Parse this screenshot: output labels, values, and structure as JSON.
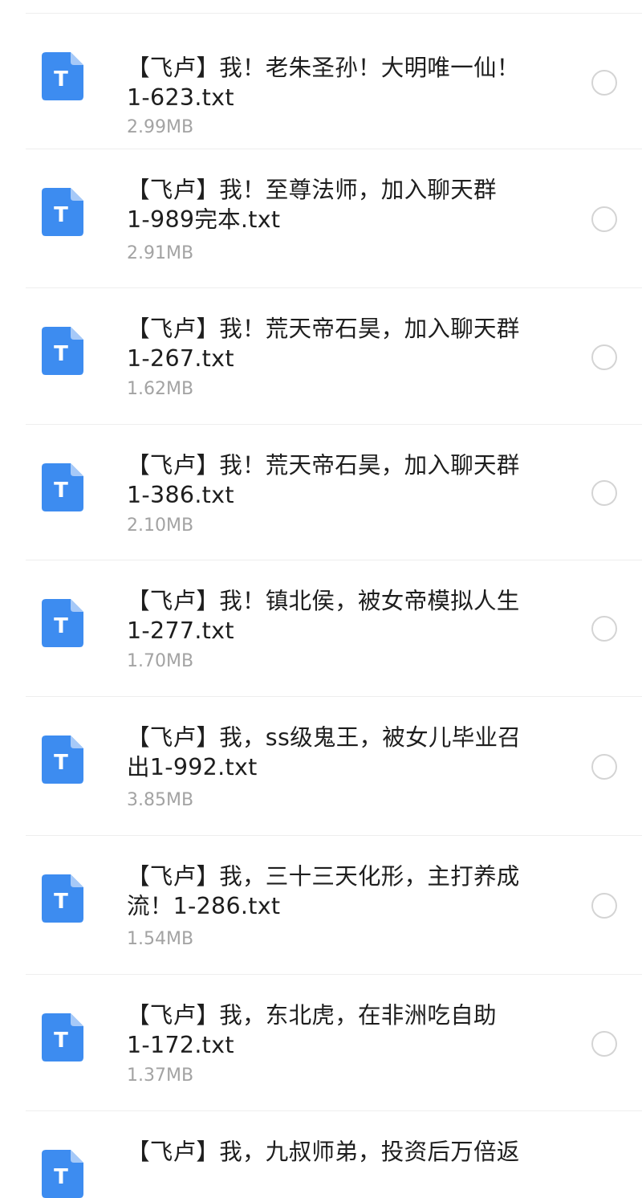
{
  "colors": {
    "icon_blue": "#3d8cf0",
    "icon_fold": "#a6c9f8",
    "name_text": "#1e1e1e",
    "size_text": "#a3a3a3",
    "radio_border": "#d4d4d4",
    "divider": "#eeeeee"
  },
  "file_icon": {
    "name": "txt-file-icon",
    "glyph": "T"
  },
  "files": [
    {
      "name": "【飞卢】我！老朱圣孙！大明唯一仙！\n1-623.txt",
      "size": "2.99MB",
      "selected": false
    },
    {
      "name": "【飞卢】我！至尊法师，加入聊天群\n1-989完本.txt",
      "size": "2.91MB",
      "selected": false
    },
    {
      "name": "【飞卢】我！荒天帝石昊，加入聊天群\n1-267.txt",
      "size": "1.62MB",
      "selected": false
    },
    {
      "name": "【飞卢】我！荒天帝石昊，加入聊天群\n1-386.txt",
      "size": "2.10MB",
      "selected": false
    },
    {
      "name": "【飞卢】我！镇北侯，被女帝模拟人生\n1-277.txt",
      "size": "1.70MB",
      "selected": false
    },
    {
      "name": "【飞卢】我，ss级鬼王，被女儿毕业召\n出1-992.txt",
      "size": "3.85MB",
      "selected": false
    },
    {
      "name": "【飞卢】我，三十三天化形，主打养成\n流！1-286.txt",
      "size": "1.54MB",
      "selected": false
    },
    {
      "name": "【飞卢】我，东北虎，在非洲吃自助\n1-172.txt",
      "size": "1.37MB",
      "selected": false
    },
    {
      "name": "【飞卢】我，九叔师弟，投资后万倍返",
      "size": "",
      "selected": false
    }
  ]
}
